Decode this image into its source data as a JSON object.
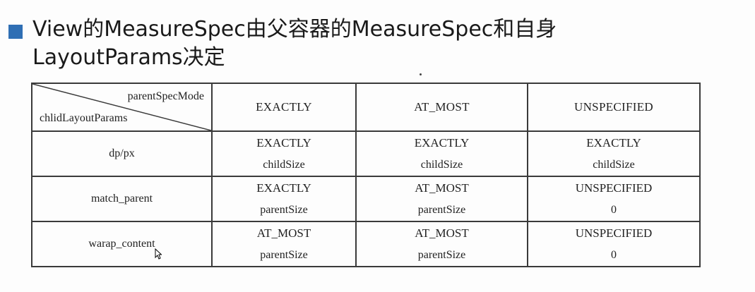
{
  "title": {
    "line1": "View的MeasureSpec由父容器的MeasureSpec和自身",
    "line2": "LayoutParams决定"
  },
  "table": {
    "corner_top": "parentSpecMode",
    "corner_bottom": "chlidLayoutParams",
    "headers": [
      "EXACTLY",
      "AT_MOST",
      "UNSPECIFIED"
    ],
    "rows": [
      {
        "label": "dp/px",
        "cells": [
          {
            "mode": "EXACTLY",
            "size": "childSize"
          },
          {
            "mode": "EXACTLY",
            "size": "childSize"
          },
          {
            "mode": "EXACTLY",
            "size": "childSize"
          }
        ]
      },
      {
        "label": "match_parent",
        "cells": [
          {
            "mode": "EXACTLY",
            "size": "parentSize"
          },
          {
            "mode": "AT_MOST",
            "size": "parentSize"
          },
          {
            "mode": "UNSPECIFIED",
            "size": "0"
          }
        ]
      },
      {
        "label": "warap_content",
        "cells": [
          {
            "mode": "AT_MOST",
            "size": "parentSize"
          },
          {
            "mode": "AT_MOST",
            "size": "parentSize"
          },
          {
            "mode": "UNSPECIFIED",
            "size": "0"
          }
        ]
      }
    ]
  },
  "colors": {
    "bullet": "#2f6fb4",
    "border": "#3a3a3a",
    "text": "#222222"
  },
  "icons": {
    "bullet": "square-bullet-icon",
    "cursor": "mouse-cursor-icon"
  }
}
